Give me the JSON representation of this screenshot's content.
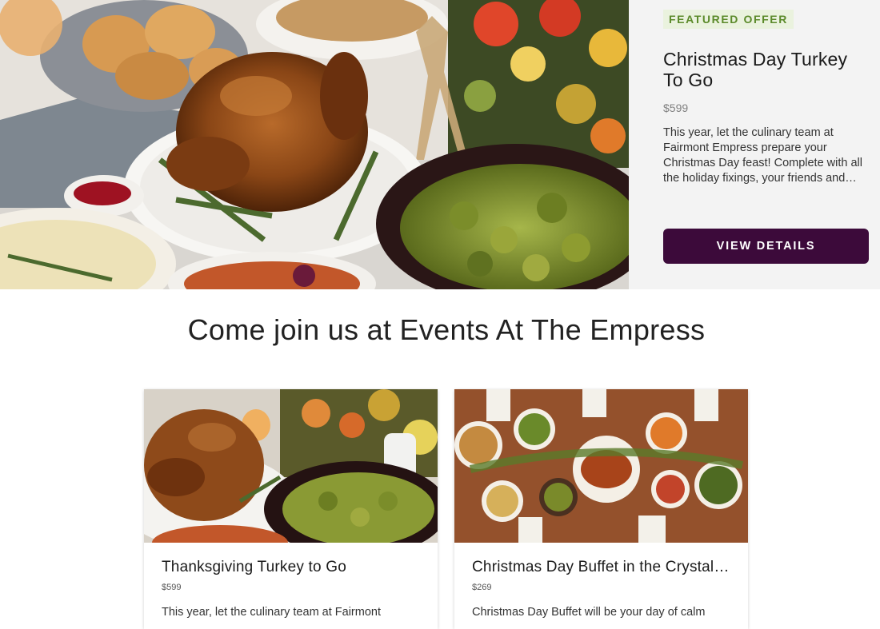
{
  "hero": {
    "badge": "FEATURED OFFER",
    "title": "Christmas Day Turkey To Go",
    "price": "$599",
    "description": "This year, let the culinary team at Fairmont Empress prepare your Christmas Day feast! Complete with all the holiday fixings, your friends and…",
    "button_label": "VIEW DETAILS",
    "image_alt": "roast turkey holiday spread"
  },
  "section": {
    "title": "Come join us at Events At The Empress"
  },
  "cards": [
    {
      "title": "Thanksgiving Turkey to Go",
      "price": "$599",
      "description": "This year, let the culinary team at Fairmont",
      "image_alt": "roast turkey with brussels sprouts"
    },
    {
      "title": "Christmas Day Buffet in the Crystal Ballroom",
      "price": "$269",
      "description": "Christmas Day Buffet will be your day of calm",
      "image_alt": "overhead holiday buffet table"
    }
  ],
  "colors": {
    "accent": "#3c0a3a",
    "badge_text": "#5b8a2a",
    "badge_bg": "#eaf2de",
    "panel_bg": "#f3f3f3"
  }
}
